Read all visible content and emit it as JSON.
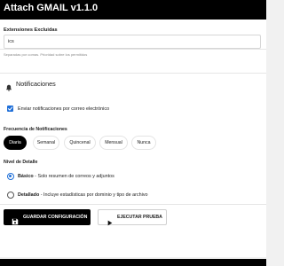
{
  "app": {
    "title": "Attach GMAIL v1.1.0"
  },
  "extensions": {
    "label": "Extensiones Excluidas",
    "value": "ics",
    "hint": "Separadas por comas. Prioridad sobre los permitidos"
  },
  "notifications": {
    "section_title": "Notificaciones",
    "icon": "bell-icon",
    "email_checkbox": {
      "label": "Enviar notificaciones por correo electrónico",
      "checked": true
    },
    "frequency": {
      "label": "Frecuencia de Notificaciones",
      "options": [
        "Diaria",
        "Semanal",
        "Quincenal",
        "Mensual",
        "Nunca"
      ],
      "selected": "Diaria"
    },
    "detail_level": {
      "label": "Nivel de Detalle",
      "options": [
        {
          "title": "Básico",
          "desc": " - Solo resumen de correos y adjuntos",
          "selected": true
        },
        {
          "title": "Detallado",
          "desc": " - Incluye estadísticas por dominio y tipo de archivo",
          "selected": false
        }
      ]
    }
  },
  "actions": {
    "save_label": "GUARDAR CONFIGURACIÓN",
    "save_icon": "save-icon",
    "run_label": "EJECUTAR PRUEBA",
    "run_icon": "play-icon"
  },
  "colors": {
    "accent": "#1f6fd8",
    "primary_button": "#000000",
    "header": "#000000"
  }
}
